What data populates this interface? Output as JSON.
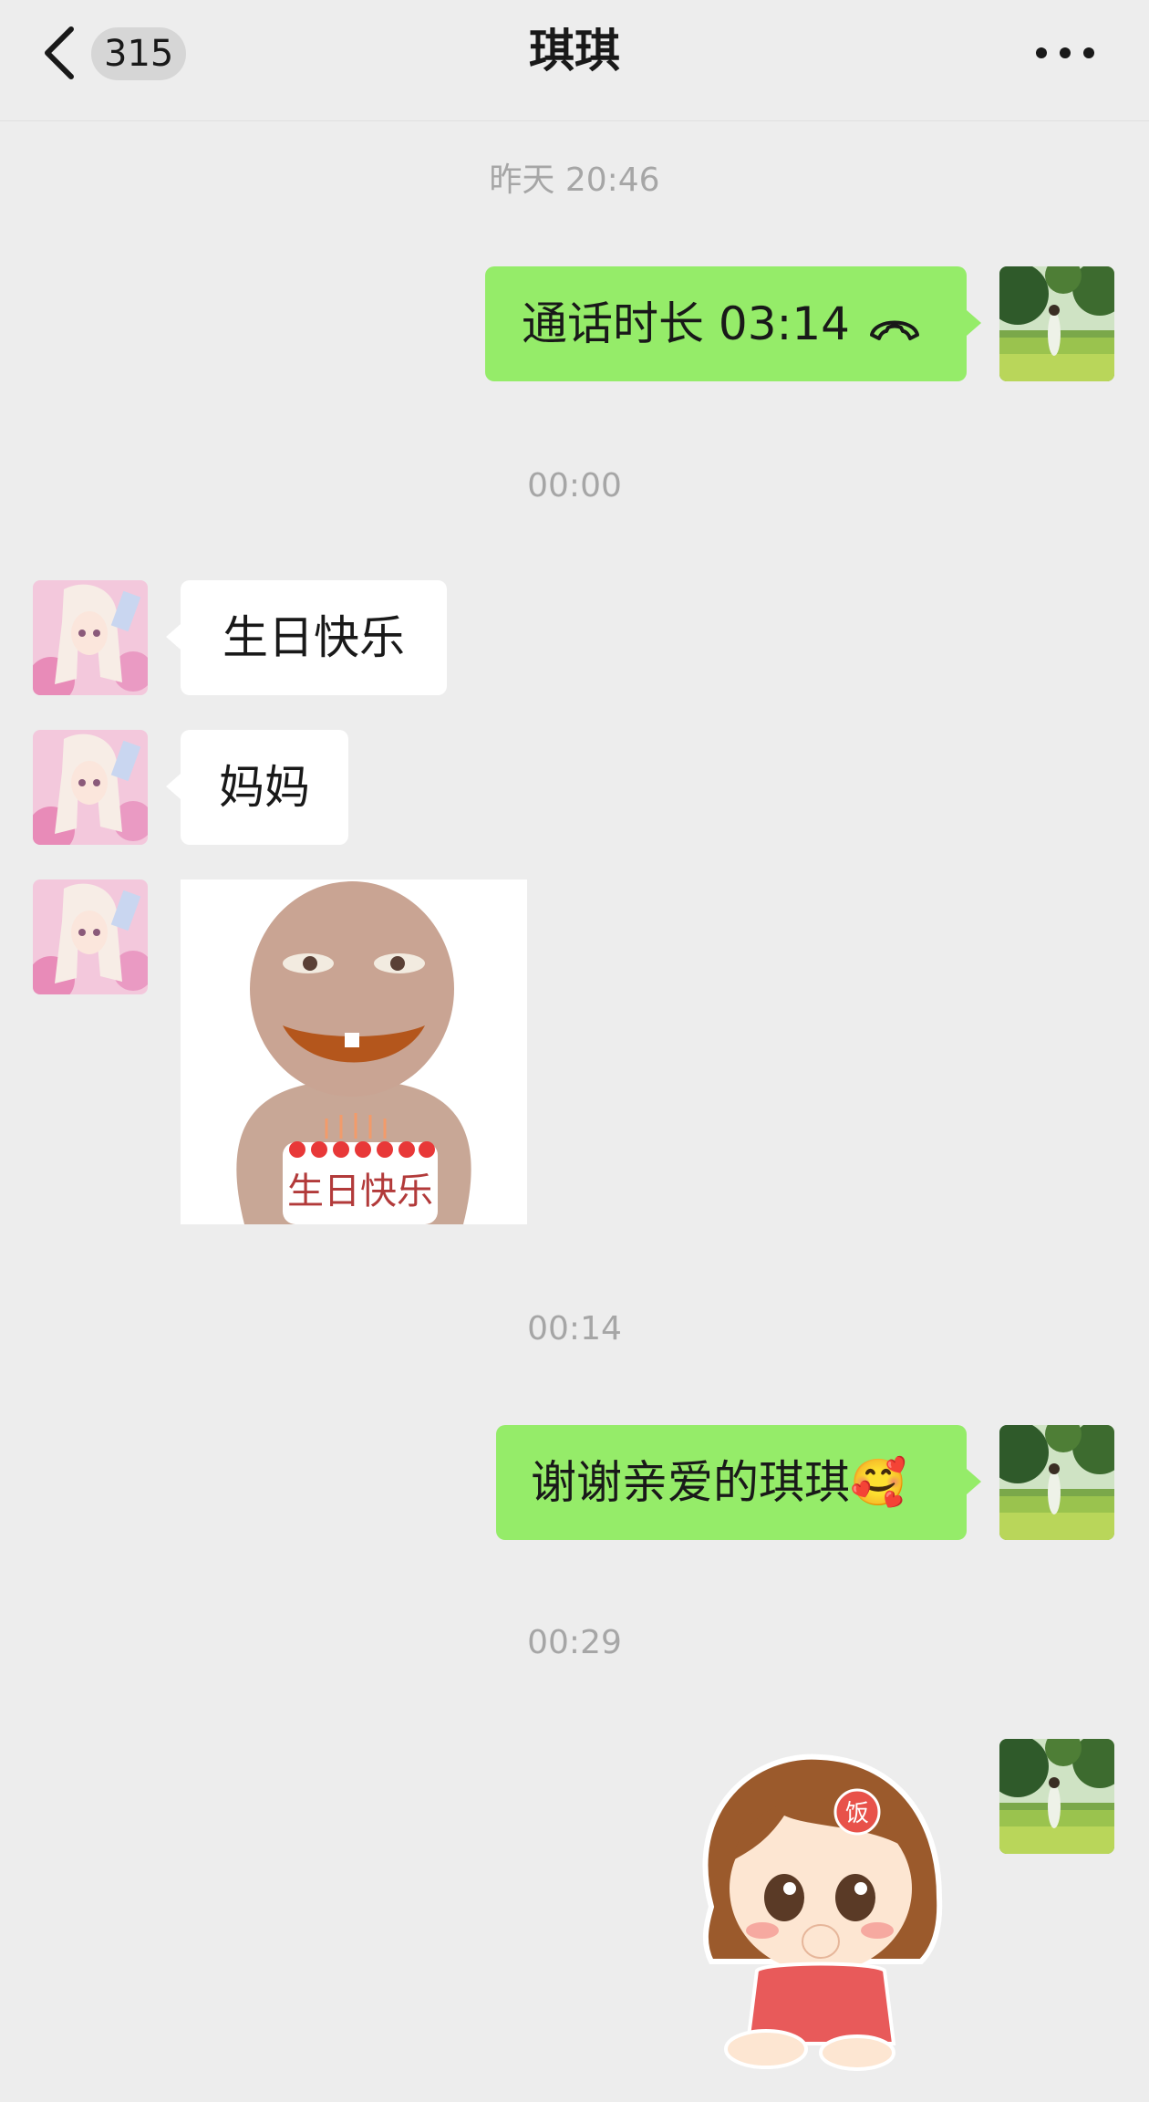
{
  "header": {
    "unread_count": "315",
    "title": "琪琪",
    "back_icon": "chevron-left-icon",
    "more_icon": "more-horizontal-icon"
  },
  "messages": {
    "ts1": "昨天 20:46",
    "call_text": "通话时长 03:14",
    "call_icon": "phone-hangup-icon",
    "ts2": "00:00",
    "msg_birthday": "生日快乐",
    "msg_mom": "妈妈",
    "sticker1_text": "生日快乐",
    "ts3": "00:14",
    "reply": "谢谢亲爱的琪琪",
    "reply_emoji": "🥰",
    "ts4": "00:29",
    "sticker2_text": "饭"
  },
  "colors": {
    "bg": "#ededed",
    "self_bubble": "#95ec69",
    "other_bubble": "#ffffff",
    "timestamp": "#a6a6a6"
  }
}
